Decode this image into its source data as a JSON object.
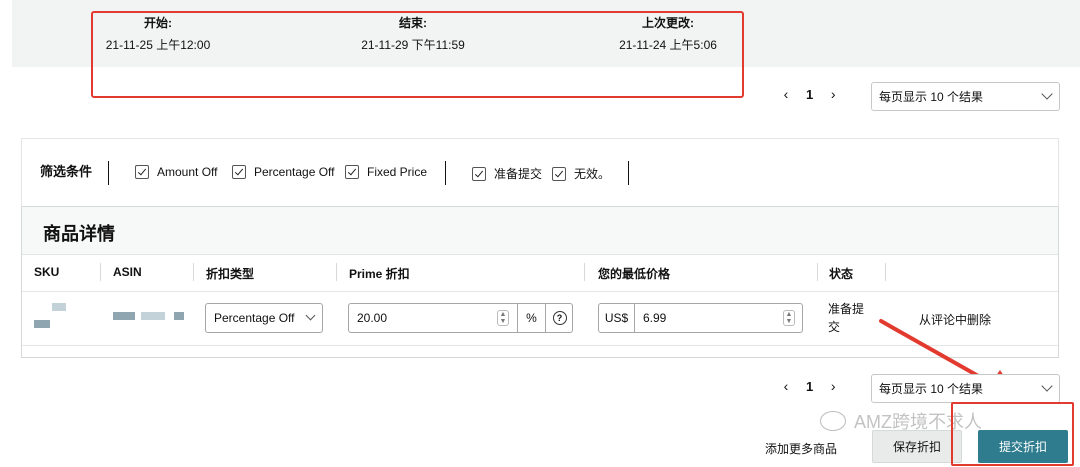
{
  "dates": {
    "start": {
      "label": "开始:",
      "value": "21-11-25 上午12:00"
    },
    "end": {
      "label": "结束:",
      "value": "21-11-29 下午11:59"
    },
    "last_modified": {
      "label": "上次更改:",
      "value": "21-11-24 上午5:06"
    }
  },
  "pagination": {
    "prev": "‹",
    "page": "1",
    "next": "›",
    "per_page": "每页显示 10 个结果"
  },
  "filters": {
    "title": "筛选条件",
    "options": [
      "Amount Off",
      "Percentage Off",
      "Fixed Price",
      "准备提交",
      "无效。"
    ]
  },
  "table": {
    "title": "商品详情",
    "headers": [
      "SKU",
      "ASIN",
      "折扣类型",
      "Prime 折扣",
      "您的最低价格",
      "状态"
    ],
    "row": {
      "discount_type": "Percentage Off",
      "prime_discount": "20.00",
      "percent_sign": "%",
      "help": "?",
      "currency": "US$",
      "min_price": "6.99",
      "status": "准备提交",
      "remove": "从评论中删除"
    }
  },
  "footer": {
    "watermark": "AMZ跨境不求人",
    "add_more": "添加更多商品",
    "save": "保存折扣",
    "submit": "提交折扣"
  },
  "colors": {
    "accent": "#2f7c8e",
    "highlight": "#e23a2e"
  }
}
